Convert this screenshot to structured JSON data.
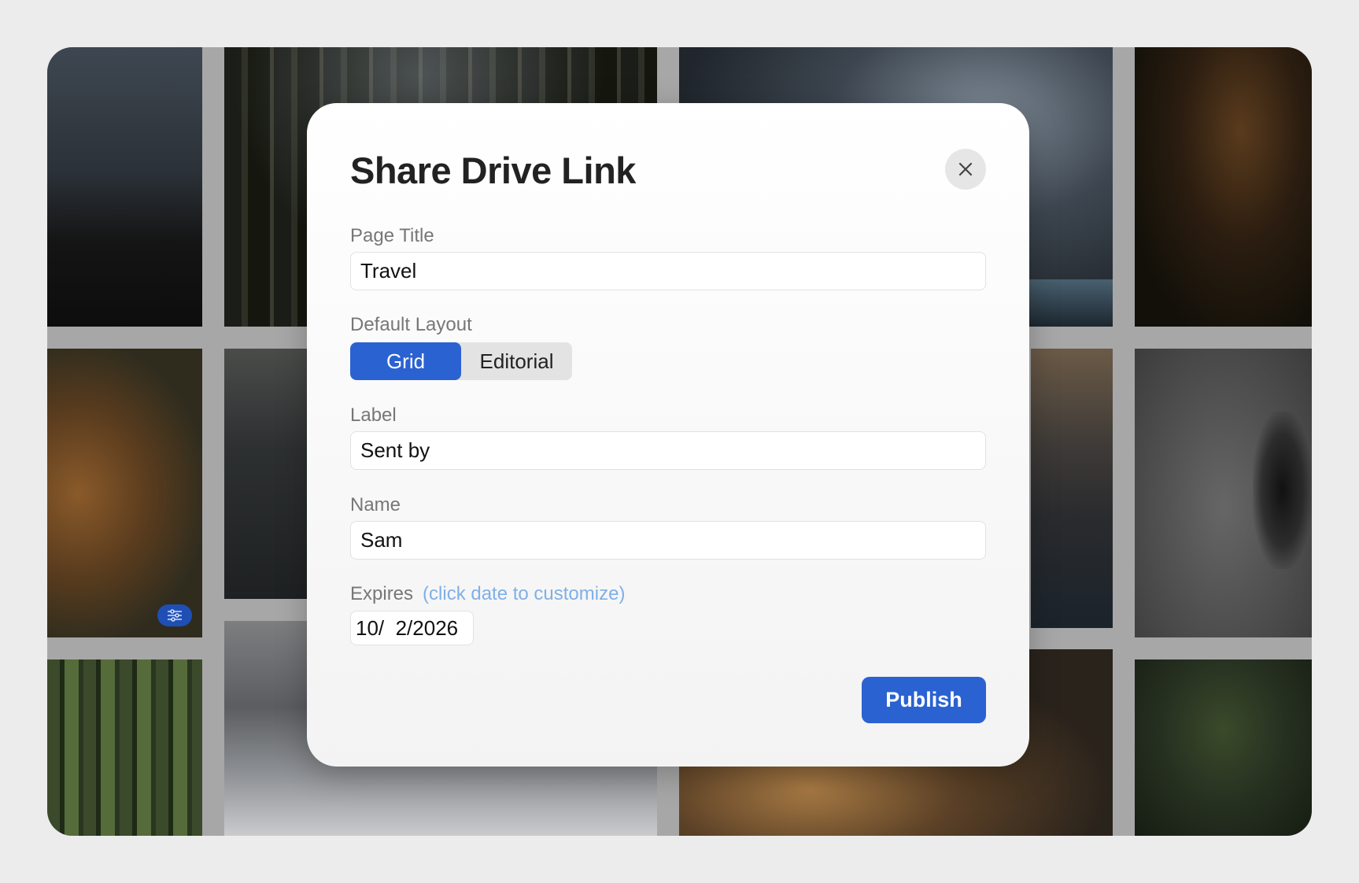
{
  "dialog": {
    "title": "Share Drive Link",
    "close_icon": "close-icon"
  },
  "page_title": {
    "label": "Page Title",
    "value": "Travel"
  },
  "layout": {
    "label": "Default Layout",
    "options": [
      "Grid",
      "Editorial"
    ],
    "selected": "Grid"
  },
  "label_field": {
    "label": "Label",
    "value": "Sent by"
  },
  "name_field": {
    "label": "Name",
    "value": "Sam"
  },
  "expires": {
    "label": "Expires",
    "hint": "(click date to customize)",
    "date": "10/  2/2026"
  },
  "publish_label": "Publish",
  "colors": {
    "accent": "#2a62d1",
    "hint": "#7fb0e8",
    "label": "#777777"
  },
  "background_chip_icon": "sliders-icon"
}
